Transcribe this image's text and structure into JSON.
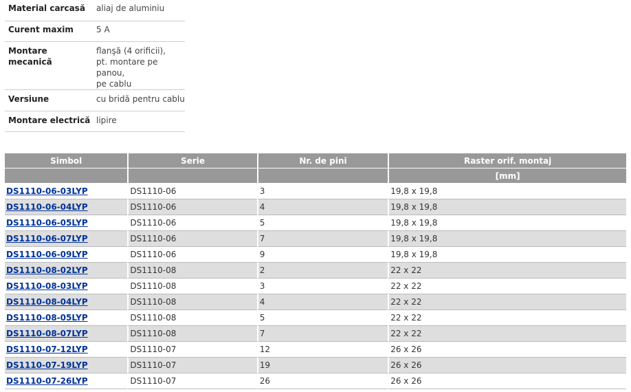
{
  "specs": [
    {
      "label": "Material carcasă",
      "value": "aliaj de aluminiu"
    },
    {
      "label": "Curent maxim",
      "value": "5 A"
    },
    {
      "label": "Montare mecanică",
      "value_lines": [
        "flanşă (4 orificii),",
        "pt. montare pe panou,",
        "pe cablu"
      ]
    },
    {
      "label": "Versiune",
      "value": "cu bridă pentru cablu"
    },
    {
      "label": "Montare electrică",
      "value": "lipire"
    }
  ],
  "table": {
    "headers": [
      "Simbol",
      "Serie",
      "Nr. de pini",
      "Raster orif. montaj"
    ],
    "subheader_unit": "[mm]",
    "rows": [
      {
        "symbol": "DS1110-06-03LYP",
        "series": "DS1110-06",
        "pins": "3",
        "raster": "19,8 x 19,8"
      },
      {
        "symbol": "DS1110-06-04LYP",
        "series": "DS1110-06",
        "pins": "4",
        "raster": "19,8 x 19,8"
      },
      {
        "symbol": "DS1110-06-05LYP",
        "series": "DS1110-06",
        "pins": "5",
        "raster": "19,8 x 19,8"
      },
      {
        "symbol": "DS1110-06-07LYP",
        "series": "DS1110-06",
        "pins": "7",
        "raster": "19,8 x 19,8"
      },
      {
        "symbol": "DS1110-06-09LYP",
        "series": "DS1110-06",
        "pins": "9",
        "raster": "19,8 x 19,8"
      },
      {
        "symbol": "DS1110-08-02LYP",
        "series": "DS1110-08",
        "pins": "2",
        "raster": "22 x 22"
      },
      {
        "symbol": "DS1110-08-03LYP",
        "series": "DS1110-08",
        "pins": "3",
        "raster": "22 x 22"
      },
      {
        "symbol": "DS1110-08-04LYP",
        "series": "DS1110-08",
        "pins": "4",
        "raster": "22 x 22"
      },
      {
        "symbol": "DS1110-08-05LYP",
        "series": "DS1110-08",
        "pins": "5",
        "raster": "22 x 22"
      },
      {
        "symbol": "DS1110-08-07LYP",
        "series": "DS1110-08",
        "pins": "7",
        "raster": "22 x 22"
      },
      {
        "symbol": "DS1110-07-12LYP",
        "series": "DS1110-07",
        "pins": "12",
        "raster": "26 x 26"
      },
      {
        "symbol": "DS1110-07-19LYP",
        "series": "DS1110-07",
        "pins": "19",
        "raster": "26 x 26"
      },
      {
        "symbol": "DS1110-07-26LYP",
        "series": "DS1110-07",
        "pins": "26",
        "raster": "26 x 26"
      }
    ]
  },
  "colors": {
    "header_bg": "#999999",
    "alt_row_bg": "#dedede",
    "link": "#003399"
  }
}
